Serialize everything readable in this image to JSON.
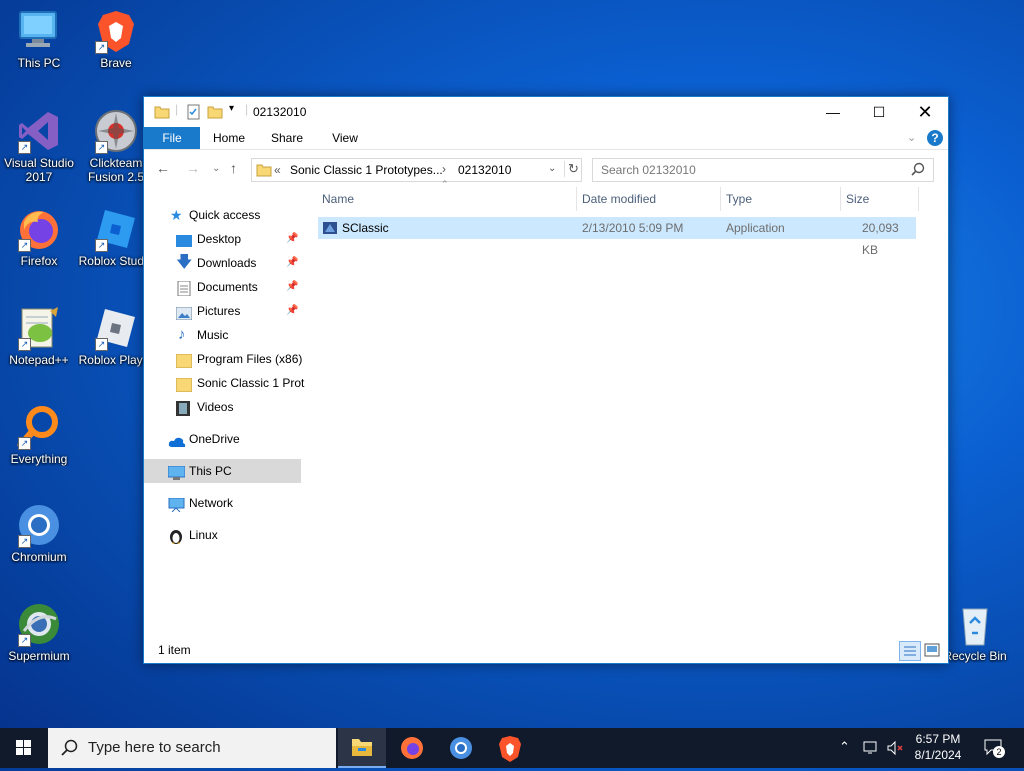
{
  "desktop": {
    "icons": [
      {
        "label": "This PC",
        "icon": "this-pc-icon"
      },
      {
        "label": "Brave",
        "icon": "brave-icon"
      },
      {
        "label": "Visual Studio\n2017",
        "line1": "Visual Studio",
        "line2": "2017",
        "icon": "visual-studio-icon"
      },
      {
        "label": "Clickteam Fusion 2.5",
        "line1": "Clickteam",
        "line2": "Fusion 2.5",
        "icon": "clickteam-fusion-icon"
      },
      {
        "label": "Firefox",
        "icon": "firefox-icon"
      },
      {
        "label": "Roblox Studio",
        "icon": "roblox-studio-icon"
      },
      {
        "label": "Notepad++",
        "icon": "notepad-plus-plus-icon"
      },
      {
        "label": "Roblox Player",
        "icon": "roblox-player-icon"
      },
      {
        "label": "Everything",
        "icon": "everything-icon"
      },
      {
        "label": "Chromium",
        "icon": "chromium-icon"
      },
      {
        "label": "Supermium",
        "icon": "supermium-icon"
      },
      {
        "label": "Recycle Bin",
        "icon": "recycle-bin-icon"
      }
    ]
  },
  "explorer": {
    "title": "02132010",
    "ribbon_tabs": [
      "File",
      "Home",
      "Share",
      "View"
    ],
    "breadcrumb": {
      "prefix": "«",
      "parent": "Sonic Classic 1 Prototypes...",
      "current": "02132010"
    },
    "search_placeholder": "Search 02132010",
    "nav": {
      "quick_access": "Quick access",
      "items": [
        "Desktop",
        "Downloads",
        "Documents",
        "Pictures",
        "Music",
        "Program Files (x86)",
        "Sonic Classic 1 Prot",
        "Videos"
      ],
      "onedrive": "OneDrive",
      "this_pc": "This PC",
      "network": "Network",
      "linux": "Linux"
    },
    "columns": [
      "Name",
      "Date modified",
      "Type",
      "Size"
    ],
    "files": [
      {
        "name": "SClassic",
        "date": "2/13/2010 5:09 PM",
        "type": "Application",
        "size": "20,093 KB"
      }
    ],
    "status": "1 item"
  },
  "taskbar": {
    "search_text": "Type here to search",
    "time": "6:57 PM",
    "date": "8/1/2024",
    "notification_count": "2"
  },
  "colors": {
    "accent": "#1979ca",
    "selection": "#cce8ff",
    "taskbar": "#101a2b"
  }
}
